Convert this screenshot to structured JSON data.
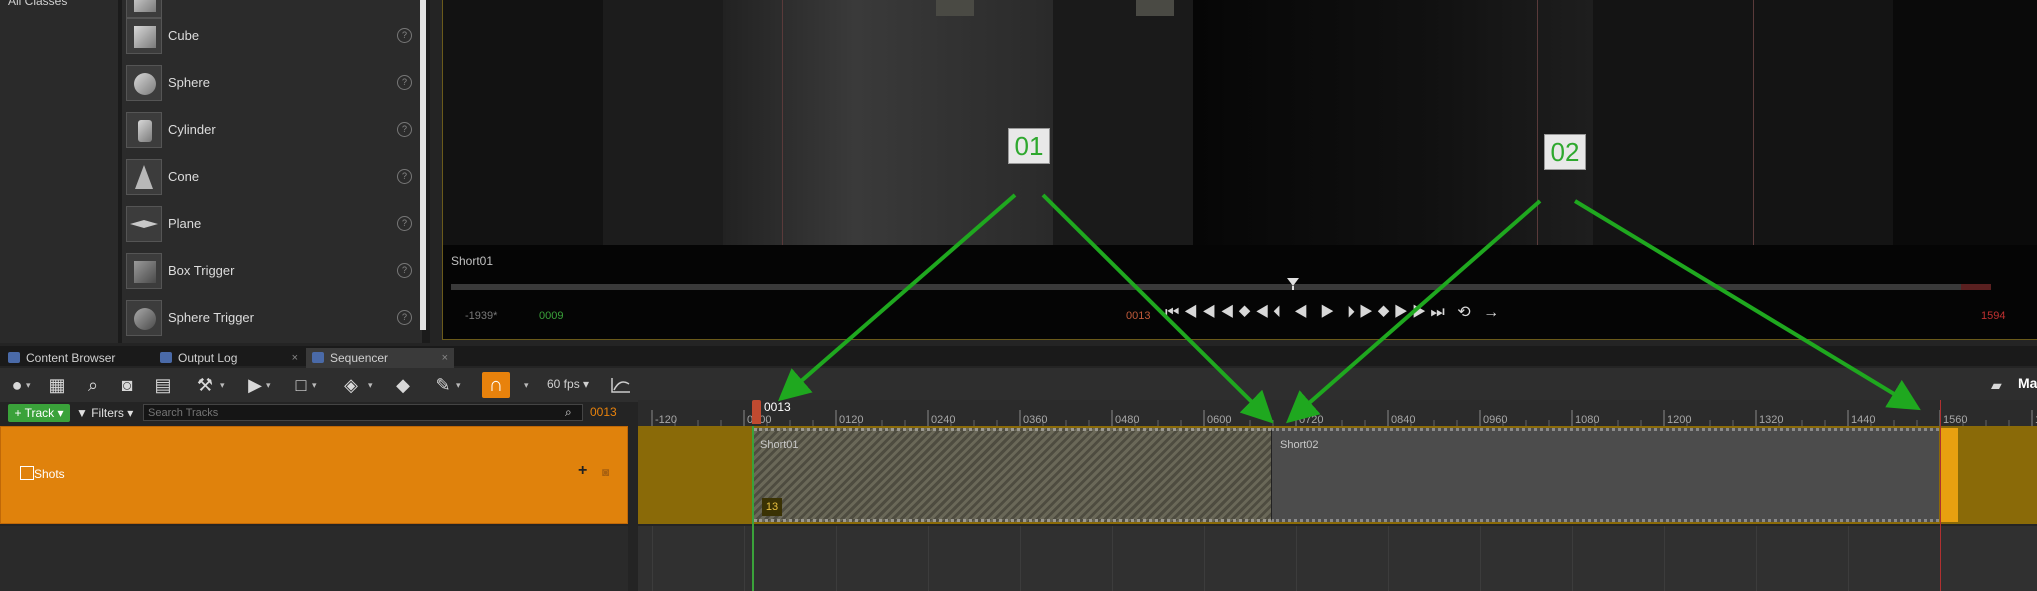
{
  "place_panel": {
    "category": "All Classes",
    "items": [
      {
        "label": "Cube",
        "icon": "cube-icon"
      },
      {
        "label": "Sphere",
        "icon": "sphere-icon"
      },
      {
        "label": "Cylinder",
        "icon": "cylinder-icon"
      },
      {
        "label": "Cone",
        "icon": "cone-icon"
      },
      {
        "label": "Plane",
        "icon": "plane-icon"
      },
      {
        "label": "Box Trigger",
        "icon": "box-trigger-icon"
      },
      {
        "label": "Sphere Trigger",
        "icon": "sphere-trigger-icon"
      }
    ],
    "help_glyph": "?"
  },
  "viewport": {
    "shot_name": "Short01",
    "callouts": [
      "01",
      "02"
    ],
    "start_frame": "-1939*",
    "in_frame": "0009",
    "current_frame": "0013",
    "end_frame": "1594",
    "transport_glyphs": "⏮◀◀◀◆◀⏴ ◀ ▶ ⏵▶◆▶▶⏭ ⟲ →"
  },
  "tabs": [
    {
      "label": "Content Browser",
      "close": "×"
    },
    {
      "label": "Output Log",
      "close": "×"
    },
    {
      "label": "Sequencer",
      "close": "×"
    }
  ],
  "toolbar": {
    "fps": "60 fps",
    "right_label": "Ma",
    "caret": "▾"
  },
  "tracks": {
    "track_button": "+ Track ▾",
    "filters_button": "▼ Filters ▾",
    "search_placeholder": "Search Tracks",
    "current_frame": "0013",
    "shots_label": "Shots",
    "add_glyph": "+"
  },
  "ruler": {
    "ticks": [
      "-120",
      "0000",
      "0120",
      "0240",
      "0360",
      "0480",
      "0600",
      "0720",
      "0840",
      "0960",
      "1080",
      "1200",
      "1320",
      "1440",
      "1560",
      "1"
    ],
    "playhead_label": "0013"
  },
  "sections": [
    {
      "label": "Short01",
      "badge": "13"
    },
    {
      "label": "Short02"
    }
  ],
  "colors": {
    "accent": "#e0820c",
    "track_green": "#3aa23a",
    "annotation_green": "#1fa81f"
  }
}
